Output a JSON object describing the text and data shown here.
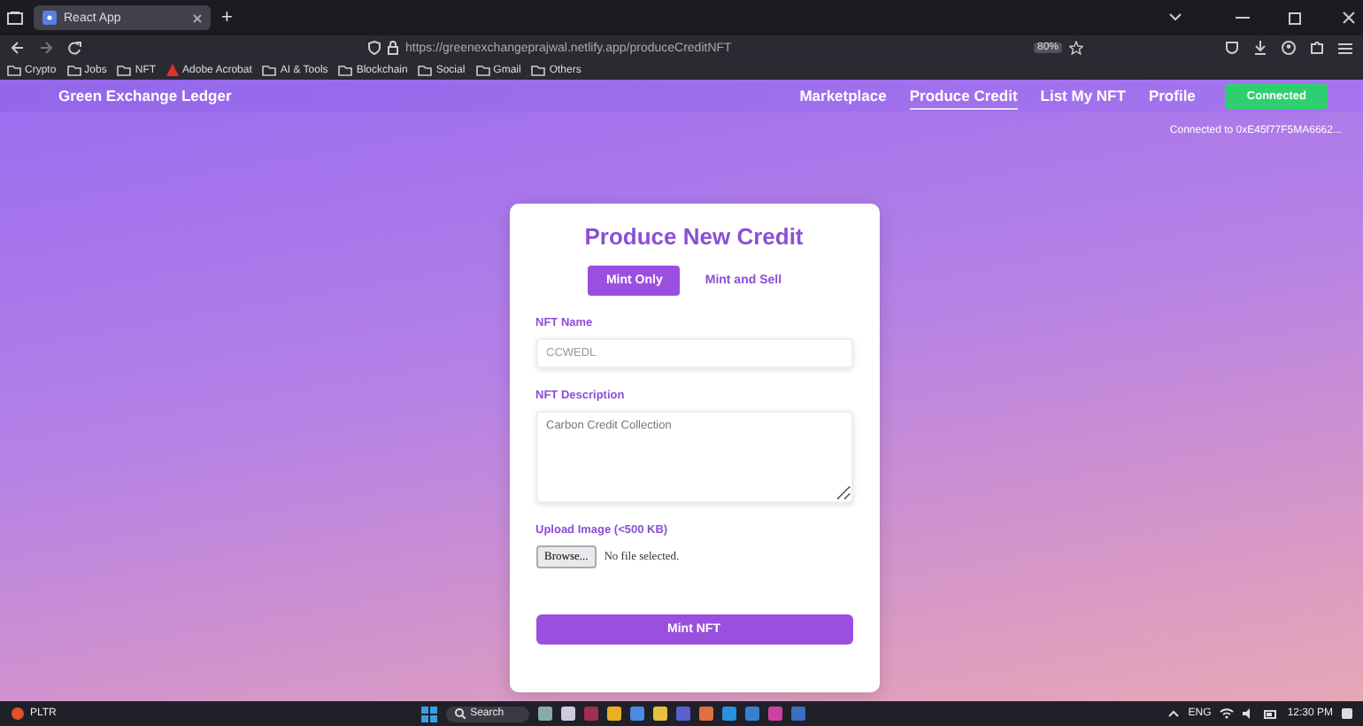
{
  "browser": {
    "tabs": [
      {
        "title": "React App",
        "selected": true
      }
    ],
    "new_tab": "+",
    "url": "https://greenexchangeprajwal.netlify.app/produceCreditNFT",
    "zoom": "80%",
    "bookmarks": [
      {
        "kind": "folder",
        "label": "Crypto"
      },
      {
        "kind": "folder",
        "label": "Jobs"
      },
      {
        "kind": "folder",
        "label": "NFT"
      },
      {
        "kind": "pdf",
        "label": "Adobe Acrobat"
      },
      {
        "kind": "folder",
        "label": "AI & Tools"
      },
      {
        "kind": "folder",
        "label": "Blockchain"
      },
      {
        "kind": "folder",
        "label": "Social"
      },
      {
        "kind": "folder",
        "label": "Gmail"
      },
      {
        "kind": "folder",
        "label": "Others"
      }
    ]
  },
  "nav": {
    "brand": "Green Exchange Ledger",
    "links": [
      {
        "label": "Marketplace",
        "selected": false
      },
      {
        "label": "Produce Credit",
        "selected": true
      },
      {
        "label": "List My NFT",
        "selected": false
      },
      {
        "label": "Profile",
        "selected": false
      }
    ],
    "wallet_button": "Connected",
    "account": "Connected to 0xE45f77F5MA6662..."
  },
  "card": {
    "title": "Produce New Credit",
    "modes": [
      {
        "label": "Mint Only",
        "selected": true
      },
      {
        "label": "Mint and Sell",
        "selected": false
      }
    ],
    "fields": [
      {
        "kind": "input",
        "label": "NFT Name",
        "value": "CCWEDL"
      },
      {
        "kind": "textarea",
        "label": "NFT Description",
        "placeholder": "Carbon Credit Collection"
      },
      {
        "kind": "file",
        "label": "Upload Image (<500 KB)",
        "button": "Browse...",
        "status": "No file selected."
      }
    ],
    "submit": "Mint NFT"
  },
  "taskbar": {
    "widget": "PLTR",
    "search": "Search",
    "language": "ENG",
    "time": "12:30 PM"
  }
}
